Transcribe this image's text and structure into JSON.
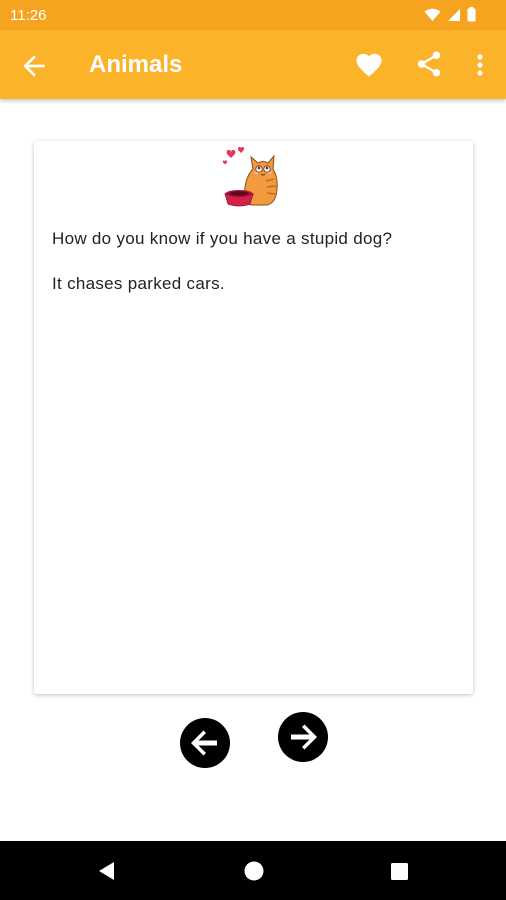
{
  "status_bar": {
    "time": "11:26"
  },
  "app_bar": {
    "title": "Animals"
  },
  "joke": {
    "question": "How do you know if you have a stupid dog?",
    "answer": "It chases parked cars."
  },
  "icons": {
    "back": "arrow-left-icon",
    "favorite": "heart-icon",
    "share": "share-icon",
    "more": "more-vert-icon",
    "previous": "circle-arrow-left-icon",
    "next": "circle-arrow-right-icon"
  },
  "colors": {
    "status_bar": "#F6A41F",
    "app_bar": "#FBB329",
    "nav_bar": "#000000",
    "text": "#222222"
  }
}
